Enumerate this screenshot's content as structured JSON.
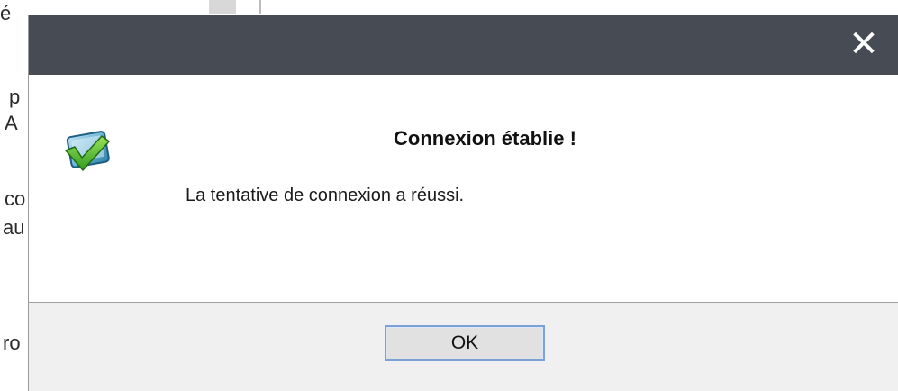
{
  "background": {
    "fragments": [
      "é",
      "p",
      "A",
      "co",
      "au",
      "ro"
    ]
  },
  "dialog": {
    "close_icon_glyph": "✕",
    "title": "Connexion établie !",
    "message": "La tentative de connexion a réussi.",
    "ok_label": "OK",
    "icon": "connection-success-check-icon",
    "colors": {
      "titlebar": "#474b53",
      "footer": "#f0f0f0",
      "button_border": "#7aa2d6",
      "check_green": "#3fae2a"
    }
  }
}
